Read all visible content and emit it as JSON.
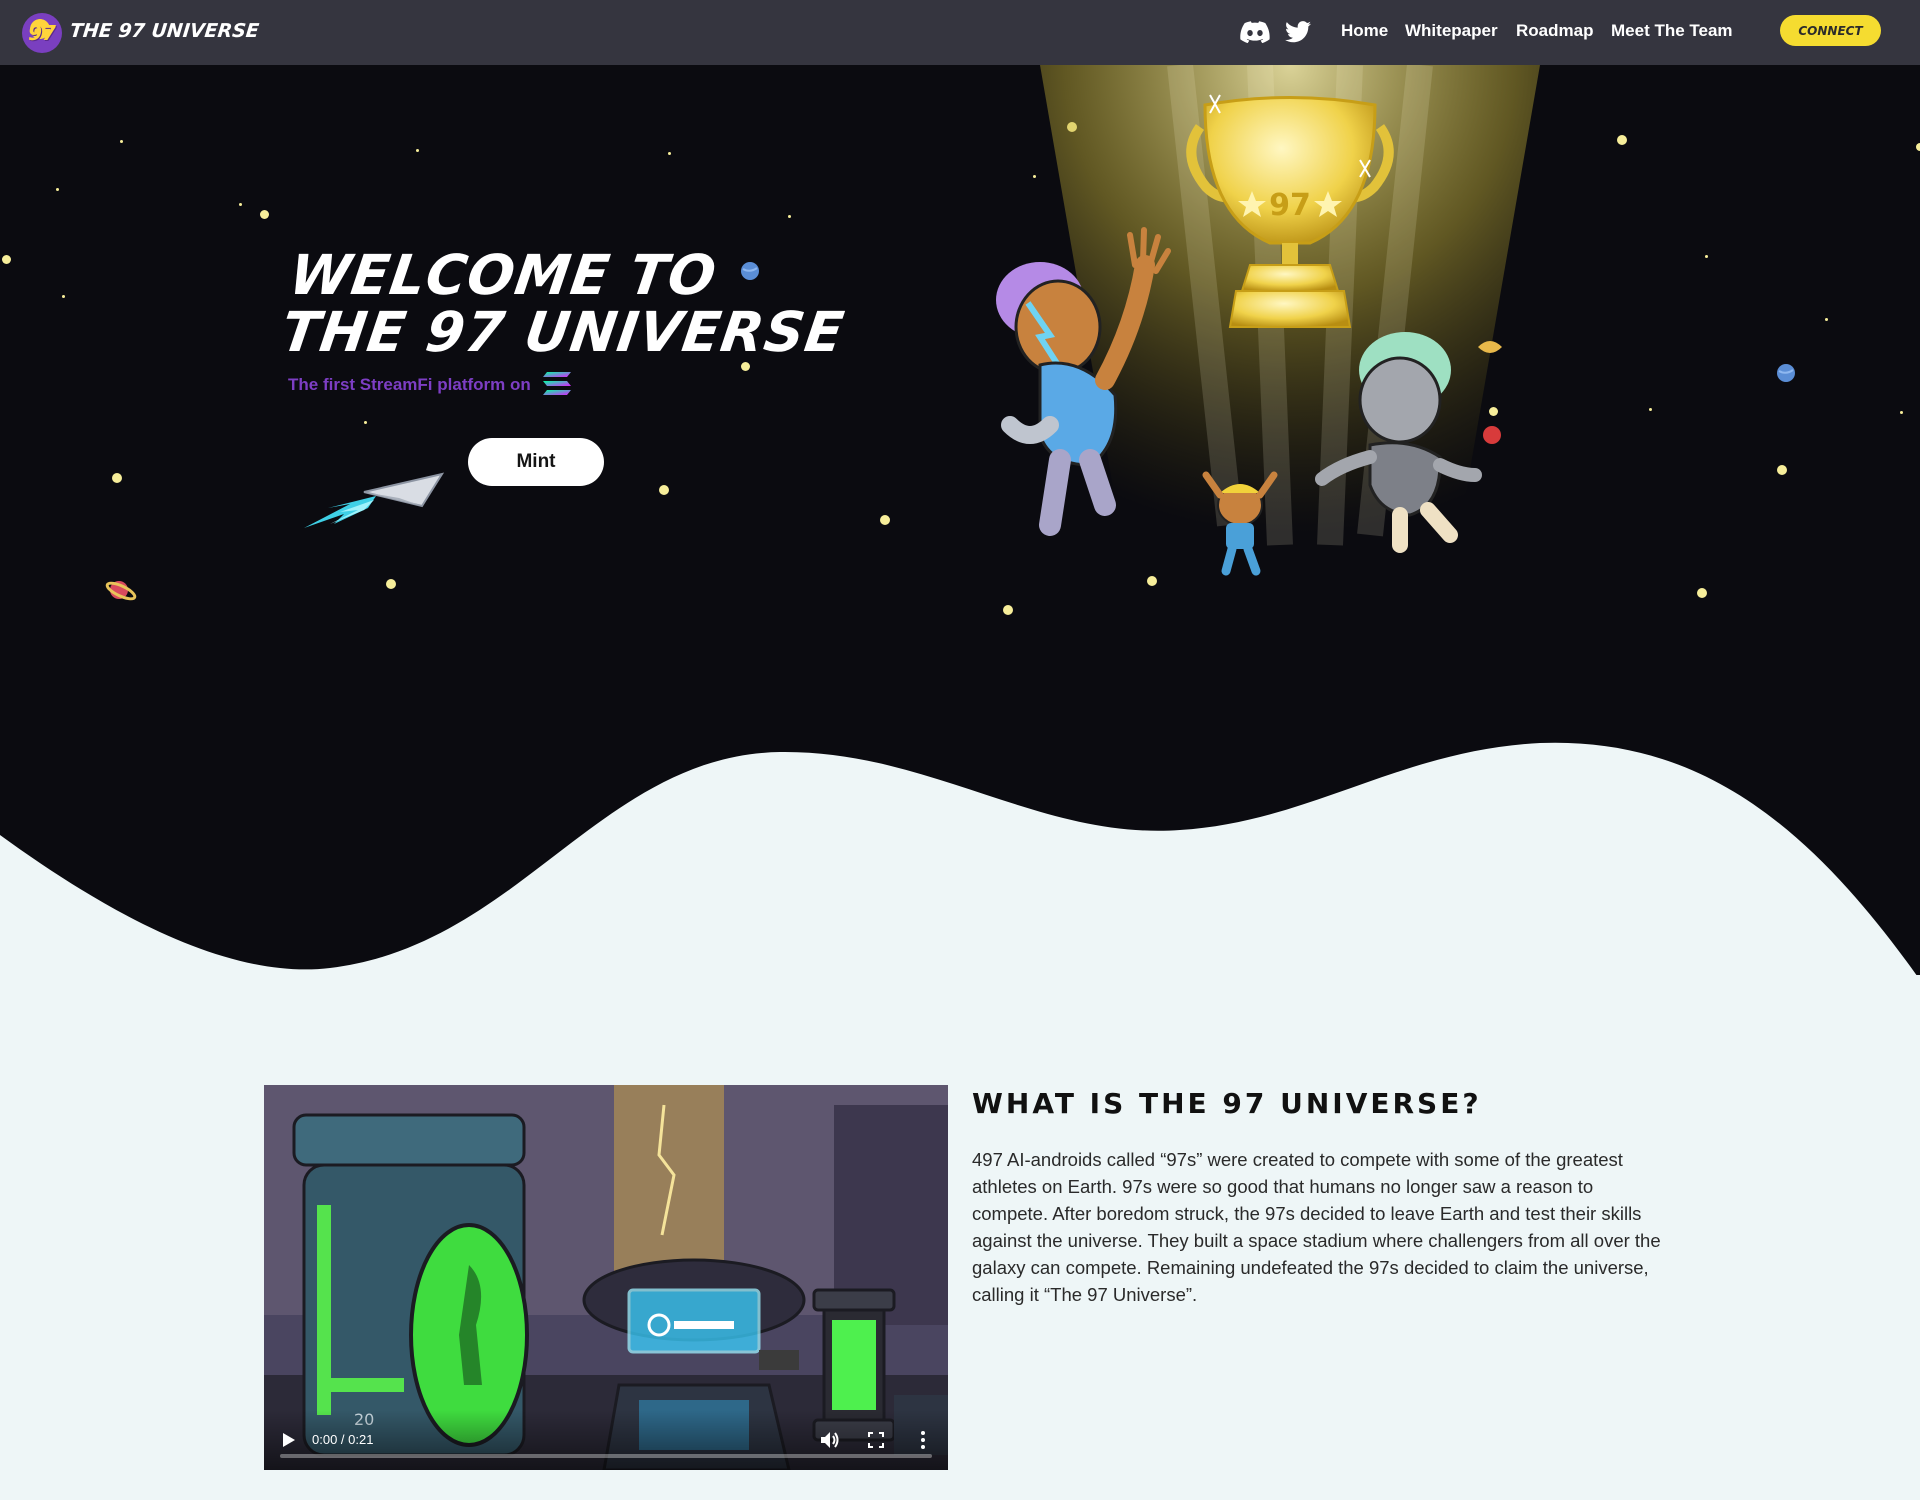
{
  "nav": {
    "brand": "THE 97 UNIVERSE",
    "logo_text": "97",
    "social": [
      {
        "icon": "discord-icon"
      },
      {
        "icon": "twitter-icon"
      }
    ],
    "links": [
      {
        "label": "Home"
      },
      {
        "label": "Whitepaper"
      },
      {
        "label": "Roadmap"
      },
      {
        "label": "Meet The Team"
      }
    ],
    "connect_label": "CONNECT"
  },
  "hero": {
    "title_line1": "WELCOME TO",
    "title_line2": "THE 97 UNIVERSE",
    "subtitle": "The first StreamFi platform on",
    "platform_icon": "solana-icon",
    "mint_label": "Mint",
    "trophy_text": "97"
  },
  "about": {
    "title": "WHAT IS THE 97 UNIVERSE?",
    "body": "497 AI-androids called “97s” were created to compete with some of the greatest athletes on Earth. 97s were so good that humans no longer saw a reason to compete. After boredom struck, the 97s decided to leave Earth and test their skills against the universe. They built a space stadium where challengers from all over the galaxy can compete. Remaining undefeated the 97s decided to claim the universe, calling it “The 97 Universe”.",
    "video": {
      "time": "0:00 / 0:21",
      "progress": 0,
      "pod_number": "20"
    }
  },
  "colors": {
    "nav_bg": "#35353f",
    "hero_bg": "#0b0b10",
    "page_bg": "#eef6f7",
    "accent_yellow": "#f5dc30",
    "subtitle_purple": "#7d3ec4",
    "star": "#f7ee9a"
  }
}
